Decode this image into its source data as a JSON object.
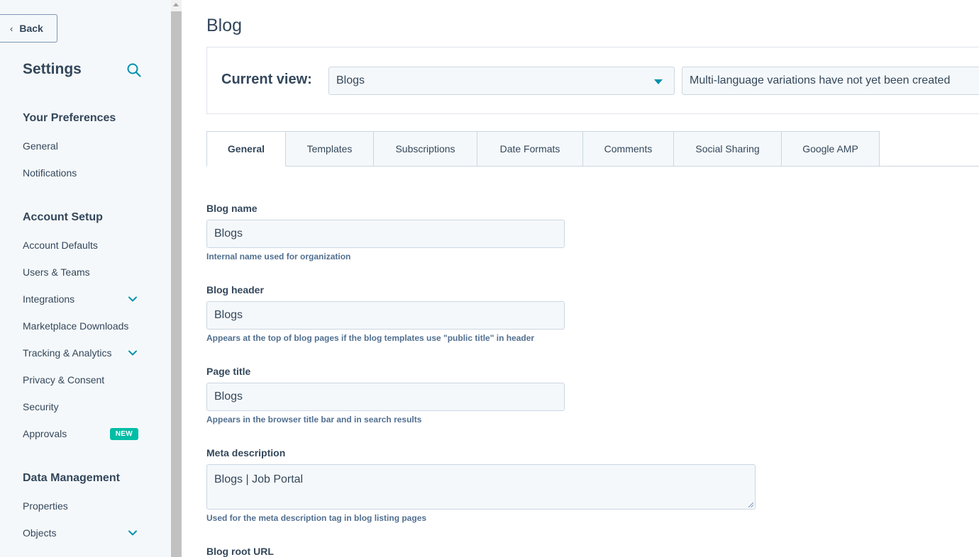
{
  "sidebar": {
    "back_label": "Back",
    "title": "Settings",
    "sections": [
      {
        "heading": "Your Preferences",
        "items": [
          {
            "label": "General"
          },
          {
            "label": "Notifications"
          }
        ]
      },
      {
        "heading": "Account Setup",
        "items": [
          {
            "label": "Account Defaults"
          },
          {
            "label": "Users & Teams"
          },
          {
            "label": "Integrations",
            "expandable": true
          },
          {
            "label": "Marketplace Downloads"
          },
          {
            "label": "Tracking & Analytics",
            "expandable": true
          },
          {
            "label": "Privacy & Consent"
          },
          {
            "label": "Security"
          },
          {
            "label": "Approvals",
            "badge": "NEW"
          }
        ]
      },
      {
        "heading": "Data Management",
        "items": [
          {
            "label": "Properties"
          },
          {
            "label": "Objects",
            "expandable": true
          }
        ]
      }
    ]
  },
  "main": {
    "page_title": "Blog",
    "current_view": {
      "label": "Current view:",
      "selected": "Blogs",
      "language_note": "Multi-language variations have not yet been created"
    },
    "tabs": [
      {
        "label": "General",
        "active": true
      },
      {
        "label": "Templates"
      },
      {
        "label": "Subscriptions"
      },
      {
        "label": "Date Formats"
      },
      {
        "label": "Comments"
      },
      {
        "label": "Social Sharing"
      },
      {
        "label": "Google AMP"
      }
    ],
    "form": {
      "blog_name": {
        "label": "Blog name",
        "value": "Blogs",
        "help": "Internal name used for organization"
      },
      "blog_header": {
        "label": "Blog header",
        "value": "Blogs",
        "help": "Appears at the top of blog pages if the blog templates use \"public title\" in header"
      },
      "page_title": {
        "label": "Page title",
        "value": "Blogs",
        "help": "Appears in the browser title bar and in search results"
      },
      "meta_description": {
        "label": "Meta description",
        "value": "Blogs | Job Portal",
        "help": "Used for the meta description tag in blog listing pages"
      },
      "blog_root_url": {
        "label": "Blog root URL"
      }
    }
  },
  "colors": {
    "accent": "#0091ae",
    "badge": "#00bda5",
    "text": "#33475b",
    "sidebar_bg": "#f5f8fa"
  }
}
